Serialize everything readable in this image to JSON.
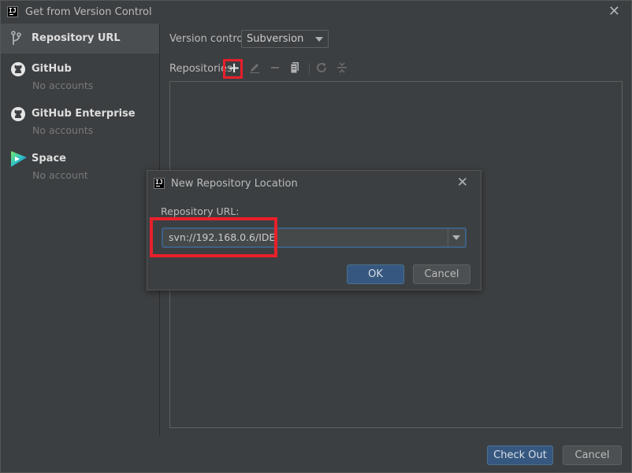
{
  "window": {
    "title": "Get from Version Control",
    "app_icon_text": "IJ",
    "close_glyph": "✕"
  },
  "sidebar": {
    "items": [
      {
        "label": "Repository URL",
        "sub": "",
        "icon": "branch-icon",
        "selected": true
      },
      {
        "label": "GitHub",
        "sub": "No accounts",
        "icon": "github-icon",
        "selected": false
      },
      {
        "label": "GitHub Enterprise",
        "sub": "No accounts",
        "icon": "github-icon",
        "selected": false
      },
      {
        "label": "Space",
        "sub": "No account",
        "icon": "space-icon",
        "selected": false
      }
    ]
  },
  "main": {
    "version_control_label": "Version control:",
    "version_control_value": "Subversion",
    "repositories_label": "Repositories:",
    "toolbar": [
      "add-icon",
      "edit-icon",
      "remove-icon",
      "copy-icon",
      "refresh-icon",
      "collapse-icon"
    ]
  },
  "buttons": {
    "checkout": "Check Out",
    "cancel": "Cancel"
  },
  "dialog": {
    "title": "New Repository Location",
    "close_glyph": "✕",
    "url_label": "Repository URL:",
    "url_value": "svn://192.168.0.6/IDE",
    "ok": "OK",
    "cancel": "Cancel"
  },
  "colors": {
    "background": "#3c3f41",
    "selection": "#4b4e51",
    "primary_button": "#365880",
    "highlight_annotation": "#e8202a"
  }
}
